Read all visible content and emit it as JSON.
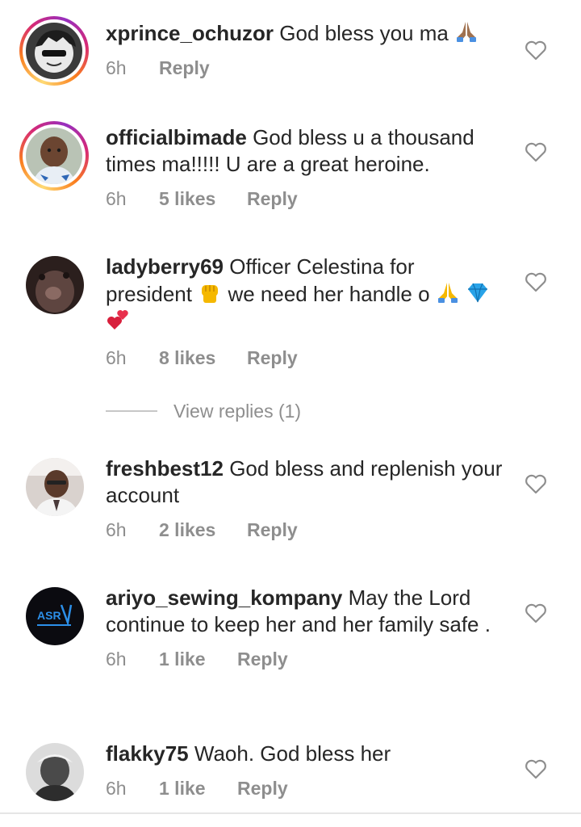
{
  "comments": [
    {
      "username": "xprince_ochuzor",
      "text": "God bless you ma",
      "time": "6h",
      "likes": "",
      "reply": "Reply",
      "avatar_icon": "avatar-cartoon",
      "story_ring": true
    },
    {
      "username": "officialbimade",
      "text": "God bless u a thousand times ma!!!!! U are a great heroine.",
      "time": "6h",
      "likes": "5 likes",
      "reply": "Reply",
      "avatar_icon": "avatar-baby-photo",
      "story_ring": true
    },
    {
      "username": "ladyberry69",
      "text_a": "Officer Celestina for president",
      "text_b": "we need her handle o",
      "time": "6h",
      "likes": "8 likes",
      "reply": "Reply",
      "avatar_icon": "avatar-face-closeup",
      "story_ring": false
    },
    {
      "username": "freshbest12",
      "text": "God bless and replenish your account",
      "time": "6h",
      "likes": "2 likes",
      "reply": "Reply",
      "avatar_icon": "avatar-man-photo",
      "story_ring": false
    },
    {
      "username": "ariyo_sewing_kompany",
      "text": "May the Lord continue to keep her and her family safe .",
      "time": "6h",
      "likes": "1 like",
      "reply": "Reply",
      "avatar_icon": "avatar-logo-asr",
      "story_ring": false
    },
    {
      "username": "flakky75",
      "text": "Waoh. God bless her",
      "time": "6h",
      "likes": "1 like",
      "reply": "Reply",
      "avatar_icon": "avatar-dark-photo",
      "story_ring": false
    }
  ],
  "view_replies": "View replies (1)",
  "icons": {
    "like": "heart-outline-icon",
    "pray": "folded-hands-emoji",
    "fist": "raised-fist-emoji",
    "gem": "gem-emoji",
    "hearts": "two-hearts-emoji"
  },
  "colors": {
    "text": "#262626",
    "meta": "#8e8e8e",
    "story_ring_start": "#feda75",
    "story_ring_end": "#962fbf"
  }
}
